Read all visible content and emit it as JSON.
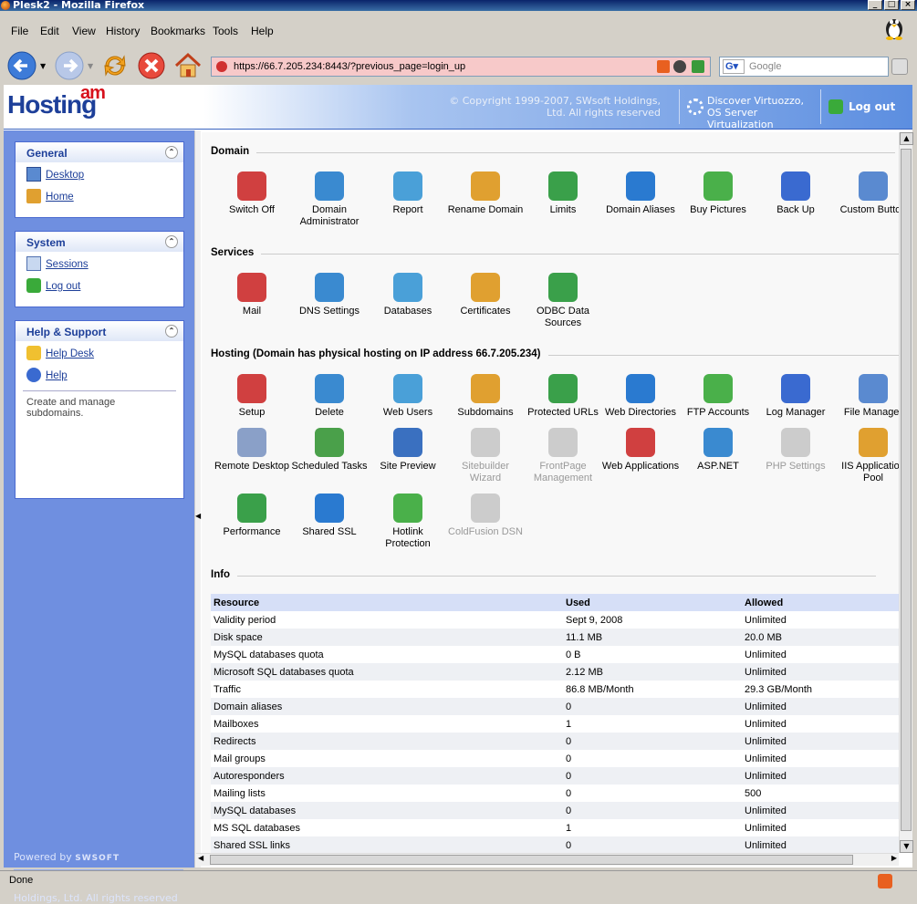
{
  "window": {
    "title": "Plesk2 - Mozilla Firefox"
  },
  "menu": [
    "File",
    "Edit",
    "View",
    "History",
    "Bookmarks",
    "Tools",
    "Help"
  ],
  "url": "https://66.7.205.234:8443/?previous_page=login_up",
  "search": {
    "placeholder": "Google"
  },
  "header": {
    "logo_main": "Hosting",
    "logo_sup": "am",
    "copyright": "© Copyright 1999-2007, SWsoft Holdings, Ltd. All rights reserved",
    "discover_line1": "Discover Virtuozzo,",
    "discover_line2": "OS Server Virtualization",
    "logout": "Log out"
  },
  "sidebar": {
    "general": {
      "title": "General",
      "items": [
        {
          "label": "Desktop"
        },
        {
          "label": "Home"
        }
      ]
    },
    "system": {
      "title": "System",
      "items": [
        {
          "label": "Sessions"
        },
        {
          "label": "Log out"
        }
      ]
    },
    "help": {
      "title": "Help & Support",
      "items": [
        {
          "label": "Help Desk"
        },
        {
          "label": "Help"
        }
      ],
      "desc": "Create and manage subdomains."
    },
    "powered": "Powered by",
    "powered_brand": "SWSOFT",
    "copyright": "© Copyright 1999-2007, SWsoft Holdings, Ltd. All rights reserved"
  },
  "sections": {
    "domain": "Domain",
    "services": "Services",
    "hosting": "Hosting (Domain has physical hosting on IP address 66.7.205.234)",
    "info": "Info"
  },
  "domain_tools": [
    "Switch Off",
    "Domain Administrator",
    "Report",
    "Rename Domain",
    "Limits",
    "Domain Aliases",
    "Buy Pictures",
    "Back Up",
    "Custom Button"
  ],
  "services_tools": [
    "Mail",
    "DNS Settings",
    "Databases",
    "Certificates",
    "ODBC Data Sources"
  ],
  "hosting_tools": [
    "Setup",
    "Delete",
    "Web Users",
    "Subdomains",
    "Protected URLs",
    "Web Directories",
    "FTP Accounts",
    "Log Manager",
    "File Manager",
    "Remote Desktop",
    "Scheduled Tasks",
    "Site Preview",
    "Sitebuilder Wizard",
    "FrontPage Management",
    "Web Applications",
    "ASP.NET",
    "PHP Settings",
    "IIS Application Pool",
    "Performance",
    "Shared SSL",
    "Hotlink Protection",
    "ColdFusion DSN"
  ],
  "info_table": {
    "headers": [
      "Resource",
      "Used",
      "Allowed"
    ],
    "rows": [
      [
        "Validity period",
        "Sept 9, 2008",
        "Unlimited"
      ],
      [
        "Disk space",
        "11.1 MB",
        "20.0 MB"
      ],
      [
        "MySQL databases quota",
        "0 B",
        "Unlimited"
      ],
      [
        "Microsoft SQL databases quota",
        "2.12 MB",
        "Unlimited"
      ],
      [
        "Traffic",
        "86.8 MB/Month",
        "29.3 GB/Month"
      ],
      [
        "Domain aliases",
        "0",
        "Unlimited"
      ],
      [
        "Mailboxes",
        "1",
        "Unlimited"
      ],
      [
        "Redirects",
        "0",
        "Unlimited"
      ],
      [
        "Mail groups",
        "0",
        "Unlimited"
      ],
      [
        "Autoresponders",
        "0",
        "Unlimited"
      ],
      [
        "Mailing lists",
        "0",
        "500"
      ],
      [
        "MySQL databases",
        "0",
        "Unlimited"
      ],
      [
        "MS SQL databases",
        "1",
        "Unlimited"
      ],
      [
        "Shared SSL links",
        "0",
        "Unlimited"
      ]
    ]
  },
  "status": "Done"
}
